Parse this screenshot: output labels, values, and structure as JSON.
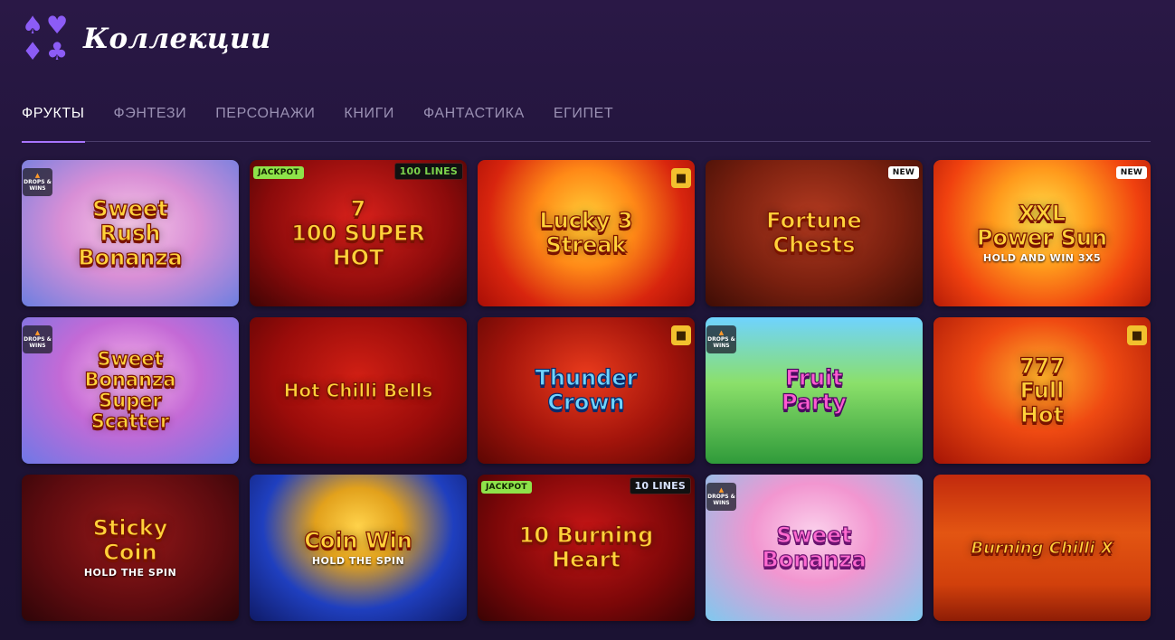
{
  "header": {
    "title": "Коллекции",
    "logo_icons": [
      "spade-icon",
      "heart-icon",
      "diamond-icon",
      "club-icon"
    ],
    "logo_color": "#8c5cf6"
  },
  "tabs": [
    {
      "label": "ФРУКТЫ",
      "active": true
    },
    {
      "label": "ФЭНТЕЗИ",
      "active": false
    },
    {
      "label": "ПЕРСОНАЖИ",
      "active": false
    },
    {
      "label": "КНИГИ",
      "active": false
    },
    {
      "label": "ФАНТАСТИКА",
      "active": false
    },
    {
      "label": "ЕГИПЕТ",
      "active": false
    }
  ],
  "drops_label": "DROPS & WINS",
  "games": [
    {
      "title": "Sweet\nRush\nBonanza",
      "badges": [
        "drops-and-wins"
      ]
    },
    {
      "title": "7\n100 SUPER HOT",
      "badges": [
        "JACKPOT",
        "100 LINES"
      ]
    },
    {
      "title": "Lucky 3\nStreak",
      "badges": [
        "gift"
      ]
    },
    {
      "title": "Fortune\nChests",
      "badges": [
        "NEW"
      ]
    },
    {
      "title": "XXL\nPower Sun",
      "subtitle": "HOLD AND WIN 3X5",
      "badges": [
        "NEW"
      ]
    },
    {
      "title": "Sweet\nBonanza\nSuper\nScatter",
      "badges": [
        "drops-and-wins"
      ]
    },
    {
      "title": "Hot Chilli Bells",
      "badges": []
    },
    {
      "title": "Thunder\nCrown",
      "badges": [
        "gift"
      ]
    },
    {
      "title": "Fruit\nParty",
      "badges": [
        "drops-and-wins"
      ]
    },
    {
      "title": "777\nFull\nHot",
      "badges": [
        "gift"
      ]
    },
    {
      "title": "Sticky\nCoin",
      "subtitle": "HOLD THE SPIN",
      "badges": []
    },
    {
      "title": "Coin Win",
      "subtitle": "HOLD THE SPIN",
      "badges": []
    },
    {
      "title": "10 Burning\nHeart",
      "badges": [
        "JACKPOT",
        "10 LINES"
      ]
    },
    {
      "title": "Sweet\nBonanza",
      "badges": [
        "drops-and-wins"
      ]
    },
    {
      "title": "Burning Chilli X",
      "badges": []
    }
  ]
}
